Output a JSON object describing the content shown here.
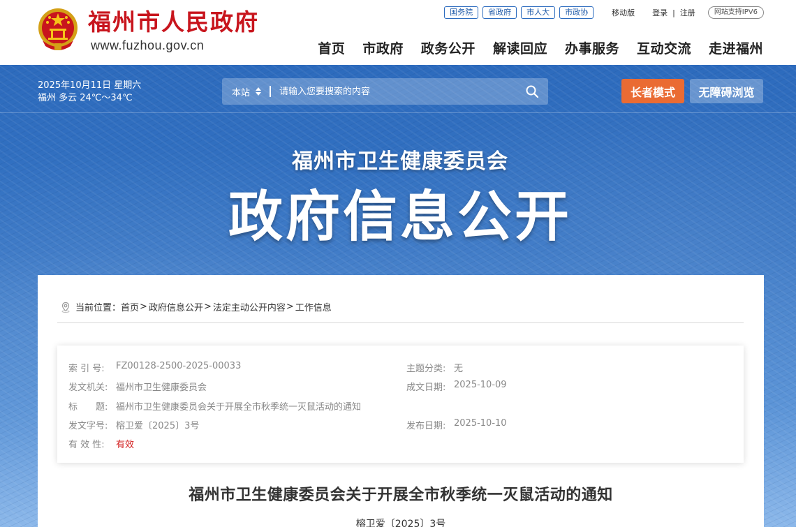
{
  "header": {
    "site_name": "福州市人民政府",
    "site_url": "www.fuzhou.gov.cn",
    "gov_links": [
      "国务院",
      "省政府",
      "市人大",
      "市政协"
    ],
    "mobile_label": "移动版",
    "login_label": "登录",
    "separator": "|",
    "register_label": "注册",
    "ipv6_label": "网站支持IPV6",
    "nav": [
      "首页",
      "市政府",
      "政务公开",
      "解读回应",
      "办事服务",
      "互动交流",
      "走进福州"
    ]
  },
  "banner": {
    "date_line": "2025年10月11日 星期六",
    "weather_line": "福州 多云 24℃～34℃",
    "search_scope": "本站",
    "search_placeholder": "请输入您要搜索的内容",
    "elder_mode_label": "长者模式",
    "accessible_label": "无障碍浏览",
    "dept_title": "福州市卫生健康委员会",
    "main_title": "政府信息公开"
  },
  "breadcrumb": {
    "prefix": "当前位置：",
    "items": [
      "首页",
      "政府信息公开",
      "法定主动公开内容",
      "工作信息"
    ],
    "arrow": ">"
  },
  "meta": {
    "index_no_label": "索 引 号:",
    "index_no": "FZ00128-2500-2025-00033",
    "topic_label": "主题分类:",
    "topic": "无",
    "issuer_label": "发文机关:",
    "issuer": "福州市卫生健康委员会",
    "created_label": "成文日期:",
    "created": "2025-10-09",
    "title_label": "标　　题:",
    "title": "福州市卫生健康委员会关于开展全市秋季统一灭鼠活动的通知",
    "doc_no_label": "发文字号:",
    "doc_no": "榕卫爱〔2025〕3号",
    "published_label": "发布日期:",
    "published": "2025-10-10",
    "validity_label": "有 效 性:",
    "validity": "有效"
  },
  "document": {
    "title": "福州市卫生健康委员会关于开展全市秋季统一灭鼠活动的通知",
    "doc_no": "榕卫爱〔2025〕3号"
  },
  "colors": {
    "brand_red": "#c8151d",
    "elder_orange": "#ea6b33",
    "banner_blue": "#2d6bbd",
    "validity_red": "#d21d1d"
  },
  "icons": [
    "national-emblem-icon",
    "sort-arrows-icon",
    "search-icon",
    "location-icon"
  ]
}
